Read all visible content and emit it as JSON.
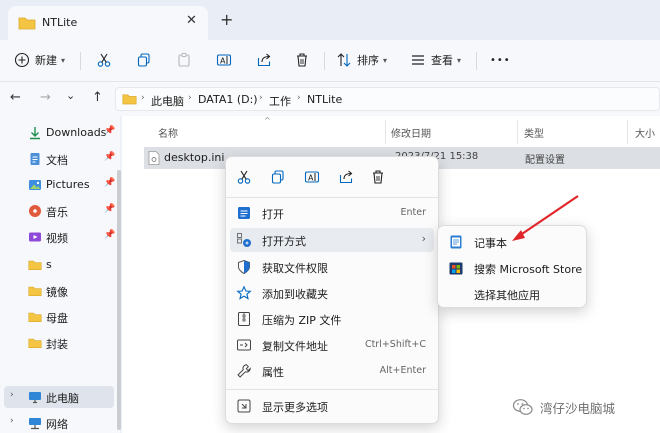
{
  "window": {
    "tab_title": "NTLite",
    "tab_close": "✕",
    "new_tab": "+"
  },
  "toolbar": {
    "new_label": "新建",
    "sort_label": "排序",
    "view_label": "查看",
    "more": "•••"
  },
  "address": {
    "back": "←",
    "forward": "→",
    "down": "⌄",
    "up": "↑",
    "crumbs": [
      "此电脑",
      "DATA1 (D:)",
      "工作",
      "NTLite"
    ]
  },
  "sidebar": {
    "items": [
      {
        "label": "Downloads",
        "icon": "download-icon"
      },
      {
        "label": "文档",
        "icon": "document-icon"
      },
      {
        "label": "Pictures",
        "icon": "pictures-icon"
      },
      {
        "label": "音乐",
        "icon": "music-icon"
      },
      {
        "label": "视频",
        "icon": "video-icon"
      },
      {
        "label": "s",
        "icon": "folder-icon"
      },
      {
        "label": "镜像",
        "icon": "folder-icon"
      },
      {
        "label": "母盘",
        "icon": "folder-icon"
      },
      {
        "label": "封装",
        "icon": "folder-icon"
      },
      {
        "label": "此电脑",
        "icon": "computer-icon"
      },
      {
        "label": "网络",
        "icon": "network-icon"
      }
    ],
    "pin": "📌",
    "expand": "›"
  },
  "filelist": {
    "columns": [
      "名称",
      "修改日期",
      "类型",
      "大小"
    ],
    "sort_caret": "^",
    "rows": [
      {
        "name": "desktop.ini",
        "date": "2023/7/21 15:38",
        "type": "配置设置"
      }
    ]
  },
  "context_menu": {
    "items": [
      {
        "label": "打开",
        "shortcut": "Enter"
      },
      {
        "label": "打开方式",
        "arrow": "›"
      },
      {
        "label": "获取文件权限"
      },
      {
        "label": "添加到收藏夹"
      },
      {
        "label": "压缩为 ZIP 文件"
      },
      {
        "label": "复制文件地址",
        "shortcut": "Ctrl+Shift+C"
      },
      {
        "label": "属性",
        "shortcut": "Alt+Enter"
      },
      {
        "label": "显示更多选项"
      }
    ]
  },
  "open_with_submenu": {
    "items": [
      {
        "label": "记事本"
      },
      {
        "label": "搜索 Microsoft Store"
      },
      {
        "label": "选择其他应用"
      }
    ]
  },
  "watermark": {
    "text": "湾仔沙电脑城"
  },
  "colors": {
    "accent": "#0067c0",
    "folder": "#f4c542",
    "arrow": "#e0262a"
  }
}
